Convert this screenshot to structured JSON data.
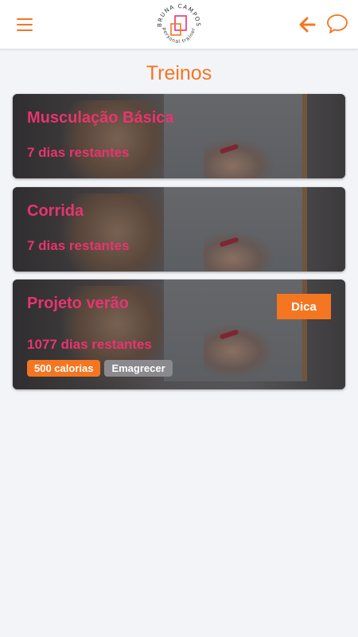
{
  "header": {
    "menu_icon": "hamburger-menu-icon",
    "logo": {
      "name": "BRUNA CAMPOS",
      "tagline": "personal trainer"
    },
    "back_icon": "arrow-left-icon",
    "chat_icon": "chat-bubble-icon",
    "accent_color": "#f47621"
  },
  "page": {
    "title": "Treinos"
  },
  "workouts": [
    {
      "title": "Musculação Básica",
      "days_left": "7 dias restantes"
    },
    {
      "title": "Corrida",
      "days_left": "7 dias restantes"
    },
    {
      "title": "Projeto verão",
      "days_left": "1077 dias restantes",
      "tip_button": "Dica",
      "tags": [
        "500 calorias",
        "Emagrecer"
      ]
    }
  ],
  "colors": {
    "title_pink": "#e8346e",
    "orange": "#f47621",
    "tag_gray": "#8a8a8e",
    "background": "#f3f4f8"
  }
}
